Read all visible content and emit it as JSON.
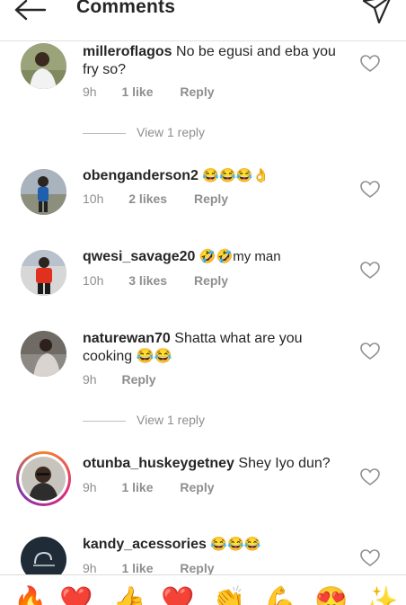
{
  "header": {
    "title": "Comments",
    "back_icon": "back-arrow-icon",
    "send_icon": "send-icon"
  },
  "comments": [
    {
      "username": "milleroflagos",
      "text": "No be egusi and eba you fry so?",
      "time": "9h",
      "likes": "1 like",
      "reply": "Reply",
      "view_replies": "View 1 reply"
    },
    {
      "username": "obenganderson2",
      "text": "😂😂😂👌",
      "time": "10h",
      "likes": "2 likes",
      "reply": "Reply"
    },
    {
      "username": "qwesi_savage20",
      "text": "🤣🤣my man",
      "time": "10h",
      "likes": "3 likes",
      "reply": "Reply"
    },
    {
      "username": "naturewan70",
      "text": "Shatta what are you cooking 😂😂",
      "time": "9h",
      "reply": "Reply",
      "view_replies": "View 1 reply"
    },
    {
      "username": "otunba_huskeygetney",
      "text": "Shey Iyo dun?",
      "time": "9h",
      "likes": "1 like",
      "reply": "Reply"
    },
    {
      "username": "kandy_acessories",
      "text": "😂😂😂",
      "time": "9h",
      "likes": "1 like",
      "reply": "Reply"
    }
  ],
  "emoji_bar": [
    "🔥",
    "❤️",
    "👍",
    "❤️",
    "👏",
    "💪",
    "😍",
    "✨"
  ],
  "colors": {
    "text": "#262626",
    "meta": "#8e8e8e",
    "divider": "#e0e0e0",
    "story_ring": "#dd2a7b"
  }
}
